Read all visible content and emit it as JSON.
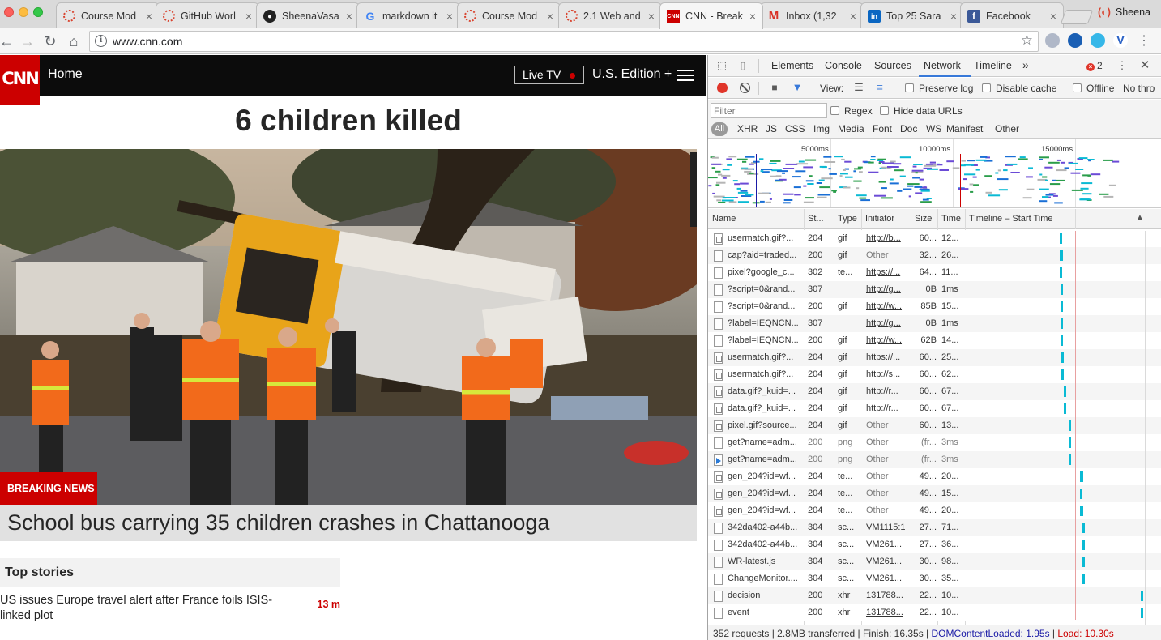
{
  "browser": {
    "tabs": [
      {
        "title": "Course Mod",
        "favicon": "ring-icon"
      },
      {
        "title": "GitHub Worl",
        "favicon": "ring-icon"
      },
      {
        "title": "SheenaVasa",
        "favicon": "github-icon"
      },
      {
        "title": "markdown it",
        "favicon": "google-icon"
      },
      {
        "title": "Course Mod",
        "favicon": "ring-icon"
      },
      {
        "title": "2.1 Web and",
        "favicon": "ring-icon"
      },
      {
        "title": "CNN - Break",
        "favicon": "cnn-icon",
        "active": true
      },
      {
        "title": "Inbox (1,32",
        "favicon": "gmail-icon"
      },
      {
        "title": "Top 25 Sara",
        "favicon": "linkedin-icon"
      },
      {
        "title": "Facebook",
        "favicon": "facebook-icon"
      }
    ],
    "profile_name": "Sheena",
    "url": "www.cnn.com"
  },
  "cnn": {
    "logo": "CNN",
    "home": "Home",
    "live_tv": "Live TV",
    "edition": "U.S. Edition +",
    "headline": "6 children killed",
    "breaking_label": "BREAKING NEWS",
    "caption": "School bus carrying 35 children crashes in Chattanooga",
    "top_stories": {
      "heading": "Top stories",
      "items": [
        {
          "text": "US issues Europe travel alert after France foils ISIS-linked plot",
          "time": "13 m"
        }
      ]
    }
  },
  "devtools": {
    "tabs": [
      "Elements",
      "Console",
      "Sources",
      "Network",
      "Timeline"
    ],
    "active_tab": "Network",
    "more": "»",
    "error_count": "2",
    "toolbar": {
      "view_label": "View:",
      "preserve_log": "Preserve log",
      "disable_cache": "Disable cache",
      "offline": "Offline",
      "throttle": "No thro"
    },
    "filter": {
      "placeholder": "Filter",
      "regex": "Regex",
      "hide_data_urls": "Hide data URLs",
      "types": [
        "All",
        "XHR",
        "JS",
        "CSS",
        "Img",
        "Media",
        "Font",
        "Doc",
        "WS",
        "Manifest",
        "Other"
      ]
    },
    "overview_labels": [
      "5000ms",
      "10000ms",
      "15000ms"
    ],
    "columns": [
      "Name",
      "St...",
      "Type",
      "Initiator",
      "Size",
      "Time",
      "Timeline – Start Time"
    ],
    "rows": [
      {
        "name": "usermatch.gif?...",
        "status": "204",
        "type": "gif",
        "initiator": "http://b...",
        "size": "60...",
        "time": "12...",
        "start": 0.52,
        "dur": 0.015,
        "icon": "img"
      },
      {
        "name": "cap?aid=traded...",
        "status": "200",
        "type": "gif",
        "initiator": "Other",
        "size": "32...",
        "time": "26...",
        "start": 0.52,
        "dur": 0.02,
        "icon": "doc"
      },
      {
        "name": "pixel?google_c...",
        "status": "302",
        "type": "te...",
        "initiator": "https://...",
        "size": "64...",
        "time": "11...",
        "start": 0.52,
        "dur": 0.014,
        "icon": "doc"
      },
      {
        "name": "?script=0&rand...",
        "status": "307",
        "type": "",
        "initiator": "http://g...",
        "size": "0B",
        "time": "1ms",
        "start": 0.525,
        "dur": 0.008,
        "icon": "doc"
      },
      {
        "name": "?script=0&rand...",
        "status": "200",
        "type": "gif",
        "initiator": "http://w...",
        "size": "85B",
        "time": "15...",
        "start": 0.525,
        "dur": 0.01,
        "icon": "doc"
      },
      {
        "name": "?label=IEQNCN...",
        "status": "307",
        "type": "",
        "initiator": "http://g...",
        "size": "0B",
        "time": "1ms",
        "start": 0.525,
        "dur": 0.008,
        "icon": "doc"
      },
      {
        "name": "?label=IEQNCN...",
        "status": "200",
        "type": "gif",
        "initiator": "http://w...",
        "size": "62B",
        "time": "14...",
        "start": 0.525,
        "dur": 0.012,
        "icon": "doc"
      },
      {
        "name": "usermatch.gif?...",
        "status": "204",
        "type": "gif",
        "initiator": "https://...",
        "size": "60...",
        "time": "25...",
        "start": 0.53,
        "dur": 0.014,
        "icon": "img"
      },
      {
        "name": "usermatch.gif?...",
        "status": "204",
        "type": "gif",
        "initiator": "http://s...",
        "size": "60...",
        "time": "62...",
        "start": 0.532,
        "dur": 0.008,
        "icon": "img"
      },
      {
        "name": "data.gif?_kuid=...",
        "status": "204",
        "type": "gif",
        "initiator": "http://r...",
        "size": "60...",
        "time": "67...",
        "start": 0.545,
        "dur": 0.015,
        "icon": "img"
      },
      {
        "name": "data.gif?_kuid=...",
        "status": "204",
        "type": "gif",
        "initiator": "http://r...",
        "size": "60...",
        "time": "67...",
        "start": 0.545,
        "dur": 0.014,
        "icon": "img"
      },
      {
        "name": "pixel.gif?source...",
        "status": "204",
        "type": "gif",
        "initiator": "Other",
        "size": "60...",
        "time": "13...",
        "start": 0.57,
        "dur": 0.012,
        "icon": "img"
      },
      {
        "name": "get?name=adm...",
        "status": "200",
        "type": "png",
        "initiator": "Other",
        "size": "(fr...",
        "time": "3ms",
        "start": 0.57,
        "dur": 0.01,
        "icon": "doc",
        "muted": true
      },
      {
        "name": "get?name=adm...",
        "status": "200",
        "type": "png",
        "initiator": "Other",
        "size": "(fr...",
        "time": "3ms",
        "start": 0.57,
        "dur": 0.01,
        "icon": "media",
        "muted": true
      },
      {
        "name": "gen_204?id=wf...",
        "status": "204",
        "type": "te...",
        "initiator": "Other",
        "size": "49...",
        "time": "20...",
        "start": 0.635,
        "dur": 0.02,
        "icon": "img"
      },
      {
        "name": "gen_204?id=wf...",
        "status": "204",
        "type": "te...",
        "initiator": "Other",
        "size": "49...",
        "time": "15...",
        "start": 0.635,
        "dur": 0.018,
        "icon": "img"
      },
      {
        "name": "gen_204?id=wf...",
        "status": "204",
        "type": "te...",
        "initiator": "Other",
        "size": "49...",
        "time": "20...",
        "start": 0.635,
        "dur": 0.02,
        "icon": "img"
      },
      {
        "name": "342da402-a44b...",
        "status": "304",
        "type": "sc...",
        "initiator": "VM1115:1",
        "size": "27...",
        "time": "71...",
        "start": 0.65,
        "dur": 0.012,
        "icon": "doc"
      },
      {
        "name": "342da402-a44b...",
        "status": "304",
        "type": "sc...",
        "initiator": "VM261...",
        "size": "27...",
        "time": "36...",
        "start": 0.65,
        "dur": 0.01,
        "icon": "doc"
      },
      {
        "name": "WR-latest.js",
        "status": "304",
        "type": "sc...",
        "initiator": "VM261...",
        "size": "30...",
        "time": "98...",
        "start": 0.65,
        "dur": 0.014,
        "icon": "doc"
      },
      {
        "name": "ChangeMonitor....",
        "status": "304",
        "type": "sc...",
        "initiator": "VM261...",
        "size": "30...",
        "time": "35...",
        "start": 0.65,
        "dur": 0.01,
        "icon": "doc"
      },
      {
        "name": "decision",
        "status": "200",
        "type": "xhr",
        "initiator": "131788...",
        "size": "22...",
        "time": "10...",
        "start": 0.985,
        "dur": 0.015,
        "icon": "doc"
      },
      {
        "name": "event",
        "status": "200",
        "type": "xhr",
        "initiator": "131788...",
        "size": "22...",
        "time": "10...",
        "start": 0.985,
        "dur": 0.015,
        "icon": "doc"
      }
    ],
    "status_bar": {
      "summary": "352 requests | 2.8MB transferred | Finish: 16.35s | ",
      "dom": "DOMContentLoaded: 1.95s",
      "sep": " | ",
      "load": "Load: 10.30s"
    }
  },
  "colors": {
    "cnn_red": "#cc0000",
    "devtools_accent": "#3879d9",
    "waterfall_bar": "#0abad4",
    "dom_blue": "#1a1aa6"
  }
}
